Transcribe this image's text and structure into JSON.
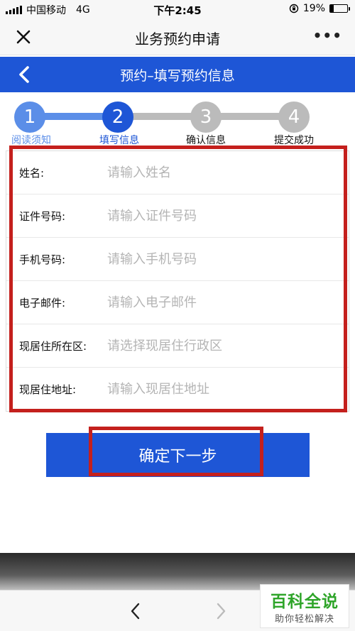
{
  "status_bar": {
    "carrier": "中国移动",
    "network": "4G",
    "time": "下午2:45",
    "battery": "19%",
    "battery_level": 0.19
  },
  "nav": {
    "title": "业务预约申请",
    "close_icon": "close-icon",
    "more_icon": "more-dots-icon",
    "more_glyph": "•••"
  },
  "page_header": {
    "title": "预约–填写预约信息",
    "back_icon": "back-arrow-icon"
  },
  "stepper": {
    "current_step": 2,
    "steps": [
      {
        "number": "1",
        "label": "阅读须知",
        "state": "done"
      },
      {
        "number": "2",
        "label": "填写信息",
        "state": "active"
      },
      {
        "number": "3",
        "label": "确认信息",
        "state": "pending"
      },
      {
        "number": "4",
        "label": "提交成功",
        "state": "pending"
      }
    ]
  },
  "form": {
    "fields": [
      {
        "label": "姓名:",
        "value": "",
        "placeholder": "请输入姓名"
      },
      {
        "label": "证件号码:",
        "value": "",
        "placeholder": "请输入证件号码"
      },
      {
        "label": "手机号码:",
        "value": "",
        "placeholder": "请输入手机号码"
      },
      {
        "label": "电子邮件:",
        "value": "",
        "placeholder": "请输入电子邮件"
      },
      {
        "label": "现居住所在区:",
        "value": "",
        "placeholder": "请选择现居住行政区"
      },
      {
        "label": "现居住地址:",
        "value": "",
        "placeholder": "请输入现居住地址"
      }
    ]
  },
  "actions": {
    "submit_label": "确定下一步"
  },
  "browser_nav": {
    "back_icon": "chevron-left-icon",
    "forward_icon": "chevron-right-icon"
  },
  "watermark": {
    "title": "百科全说",
    "subtitle": "助你轻松解决"
  },
  "colors": {
    "primary": "#1e56d6",
    "step_done": "#5b8ee8",
    "step_pending": "#bbbbbb",
    "highlight": "#c4201d",
    "watermark_green": "#2fa52a"
  }
}
